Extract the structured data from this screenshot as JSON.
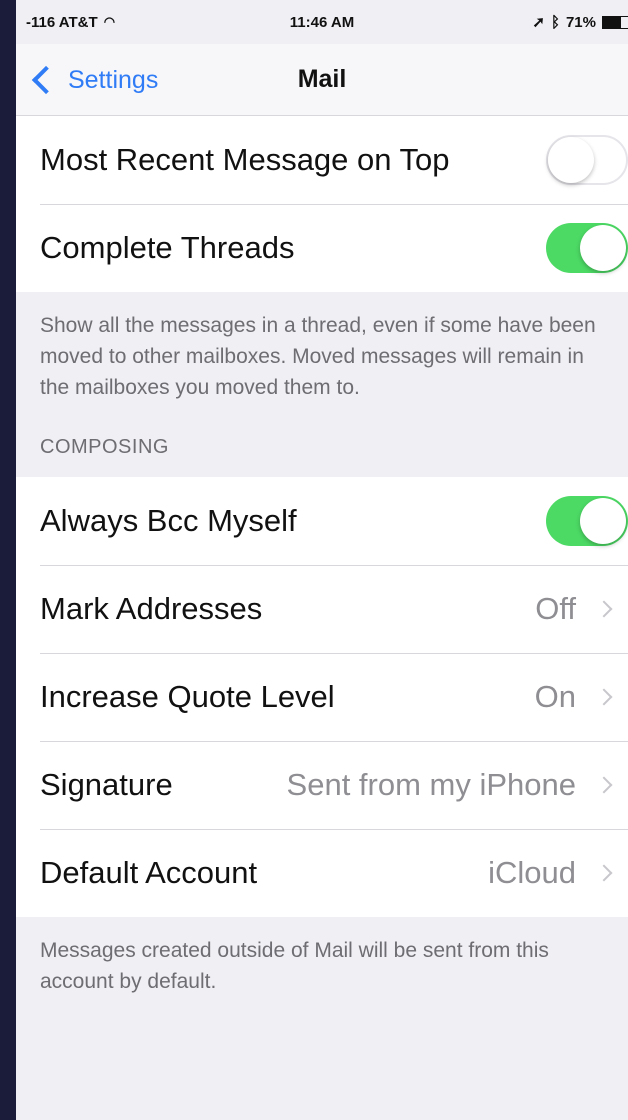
{
  "status_bar": {
    "carrier": "-116 AT&T",
    "wifi_icon": "wifi-icon",
    "time": "11:46 AM",
    "location_icon": "location-arrow-icon",
    "bluetooth_icon": "bluetooth-icon",
    "battery": "71%"
  },
  "nav": {
    "back_label": "Settings",
    "title": "Mail"
  },
  "threading": {
    "most_recent": {
      "label": "Most Recent Message on Top",
      "value": false
    },
    "complete_threads": {
      "label": "Complete Threads",
      "value": true
    },
    "footer": "Show all the messages in a thread, even if some have been moved to other mailboxes. Moved messages will remain in the mailboxes you moved them to."
  },
  "composing": {
    "header": "COMPOSING",
    "always_bcc": {
      "label": "Always Bcc Myself",
      "value": true
    },
    "mark_addresses": {
      "label": "Mark Addresses",
      "value": "Off"
    },
    "increase_quote": {
      "label": "Increase Quote Level",
      "value": "On"
    },
    "signature": {
      "label": "Signature",
      "value": "Sent from my iPhone"
    },
    "default_account": {
      "label": "Default Account",
      "value": "iCloud"
    },
    "footer": "Messages created outside of Mail will be sent from this account by default."
  },
  "colors": {
    "accent": "#2f7cf6",
    "toggle_on": "#4cd964",
    "background": "#efeff4"
  }
}
